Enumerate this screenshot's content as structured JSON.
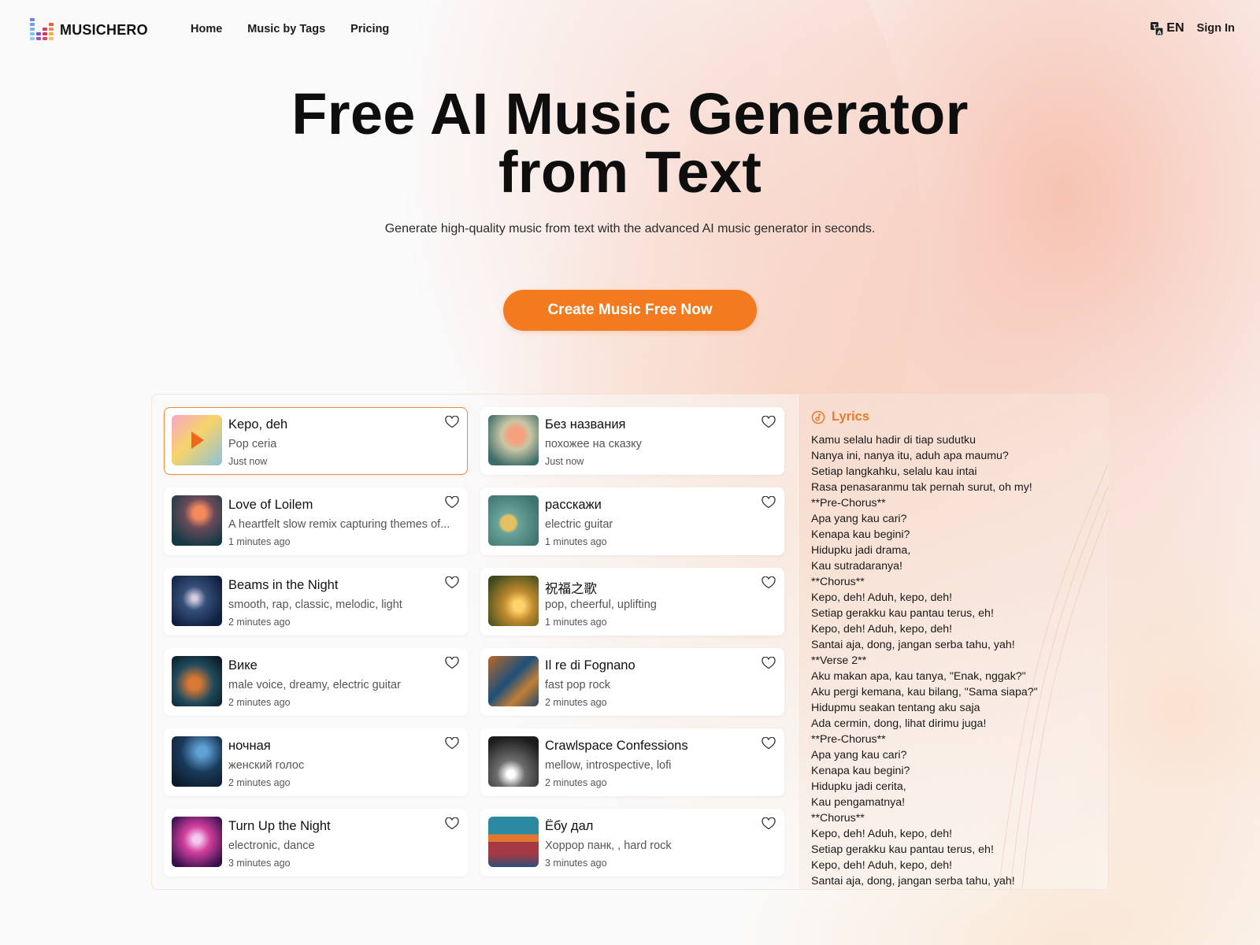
{
  "header": {
    "brand": "MUSICHERO",
    "nav": [
      {
        "label": "Home"
      },
      {
        "label": "Music by Tags"
      },
      {
        "label": "Pricing"
      }
    ],
    "language": "EN",
    "sign_in": "Sign In"
  },
  "hero": {
    "title_line1": "Free AI Music Generator",
    "title_line2": "from Text",
    "subtitle": "Generate high-quality music from text with the advanced AI music generator in seconds.",
    "cta": "Create Music Free Now"
  },
  "colors": {
    "accent": "#f47a1f",
    "lyrics_title": "#ea7a2e",
    "active_border": "#ef8a3e"
  },
  "songs": [
    {
      "title": "Kepo, deh",
      "desc": "Pop ceria",
      "time": "Just now",
      "active": true,
      "playing": true
    },
    {
      "title": "Без названия",
      "desc": "похожее на сказку",
      "time": "Just now"
    },
    {
      "title": "Love of Loilem",
      "desc": "A heartfelt slow remix capturing themes of...",
      "time": "1 minutes ago"
    },
    {
      "title": "расскажи",
      "desc": "electric guitar",
      "time": "1 minutes ago"
    },
    {
      "title": "Beams in the Night",
      "desc": "smooth, rap, classic, melodic, light",
      "time": "2 minutes ago"
    },
    {
      "title": "祝福之歌",
      "desc": "pop, cheerful, uplifting",
      "time": "1 minutes ago"
    },
    {
      "title": "Вике",
      "desc": "male voice, dreamy, electric guitar",
      "time": "2 minutes ago"
    },
    {
      "title": "Il re di Fognano",
      "desc": "fast pop rock",
      "time": "2 minutes ago"
    },
    {
      "title": "ночная",
      "desc": "женский голос",
      "time": "2 minutes ago"
    },
    {
      "title": "Crawlspace Confessions",
      "desc": "mellow, introspective, lofi",
      "time": "2 minutes ago"
    },
    {
      "title": "Turn Up the Night",
      "desc": "electronic, dance",
      "time": "3 minutes ago"
    },
    {
      "title": "Ёбу дал",
      "desc": "Хоррор панк, , hard rock",
      "time": "3 minutes ago"
    }
  ],
  "lyrics": {
    "title": "Lyrics",
    "lines": [
      "Kamu selalu hadir di tiap sudutku",
      "Nanya ini, nanya itu, aduh apa maumu?",
      "Setiap langkahku, selalu kau intai",
      "Rasa penasaranmu tak pernah surut, oh my!",
      "**Pre-Chorus**",
      "Apa yang kau cari?",
      "Kenapa kau begini?",
      "Hidupku jadi drama,",
      "Kau sutradaranya!",
      "**Chorus**",
      "Kepo, deh! Aduh, kepo, deh!",
      "Setiap gerakku kau pantau terus, eh!",
      "Kepo, deh! Aduh, kepo, deh!",
      "Santai aja, dong, jangan serba tahu, yah!",
      "**Verse 2**",
      "Aku makan apa, kau tanya, \"Enak, nggak?\"",
      "Aku pergi kemana, kau bilang, \"Sama siapa?\"",
      "Hidupmu seakan tentang aku saja",
      "Ada cermin, dong, lihat dirimu juga!",
      "**Pre-Chorus**",
      "Apa yang kau cari?",
      "Kenapa kau begini?",
      "Hidupku jadi cerita,",
      "Kau pengamatnya!",
      "**Chorus**",
      "Kepo, deh! Aduh, kepo, deh!",
      "Setiap gerakku kau pantau terus, eh!",
      "Kepo, deh! Aduh, kepo, deh!",
      "Santai aja, dong, jangan serba tahu, yah!"
    ]
  }
}
